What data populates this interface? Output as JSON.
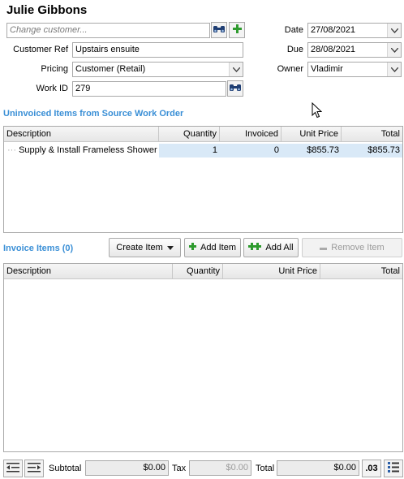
{
  "customer": {
    "name": "Julie Gibbons",
    "change_placeholder": "Change customer...",
    "ref_label": "Customer Ref",
    "ref_value": "Upstairs ensuite",
    "pricing_label": "Pricing",
    "pricing_value": "Customer (Retail)",
    "workid_label": "Work ID",
    "workid_value": "279"
  },
  "dates": {
    "date_label": "Date",
    "date_value": "27/08/2021",
    "due_label": "Due",
    "due_value": "28/08/2021",
    "owner_label": "Owner",
    "owner_value": "Vladimir"
  },
  "uninvoiced": {
    "heading": "Uninvoiced Items from Source Work Order",
    "columns": [
      "Description",
      "Quantity",
      "Invoiced",
      "Unit Price",
      "Total"
    ],
    "rows": [
      {
        "description": "Supply & Install Frameless Shower",
        "quantity": "1",
        "invoiced": "0",
        "unit_price": "$855.73",
        "total": "$855.73"
      }
    ]
  },
  "invoice": {
    "heading": "Invoice Items (0)",
    "create_item": "Create Item",
    "add_item": "Add Item",
    "add_all": "Add All",
    "remove_item": "Remove Item",
    "columns": [
      "Description",
      "Quantity",
      "Unit Price",
      "Total"
    ]
  },
  "totals": {
    "subtotal_label": "Subtotal",
    "subtotal_value": "$0.00",
    "tax_label": "Tax",
    "tax_value": "$0.00",
    "total_label": "Total",
    "total_value": "$0.00",
    "decimals_label": ".03"
  },
  "colors": {
    "section_heading": "#3a8fd6",
    "selected_row": "#d9e9f7",
    "add_icon": "#2e9b2e"
  }
}
